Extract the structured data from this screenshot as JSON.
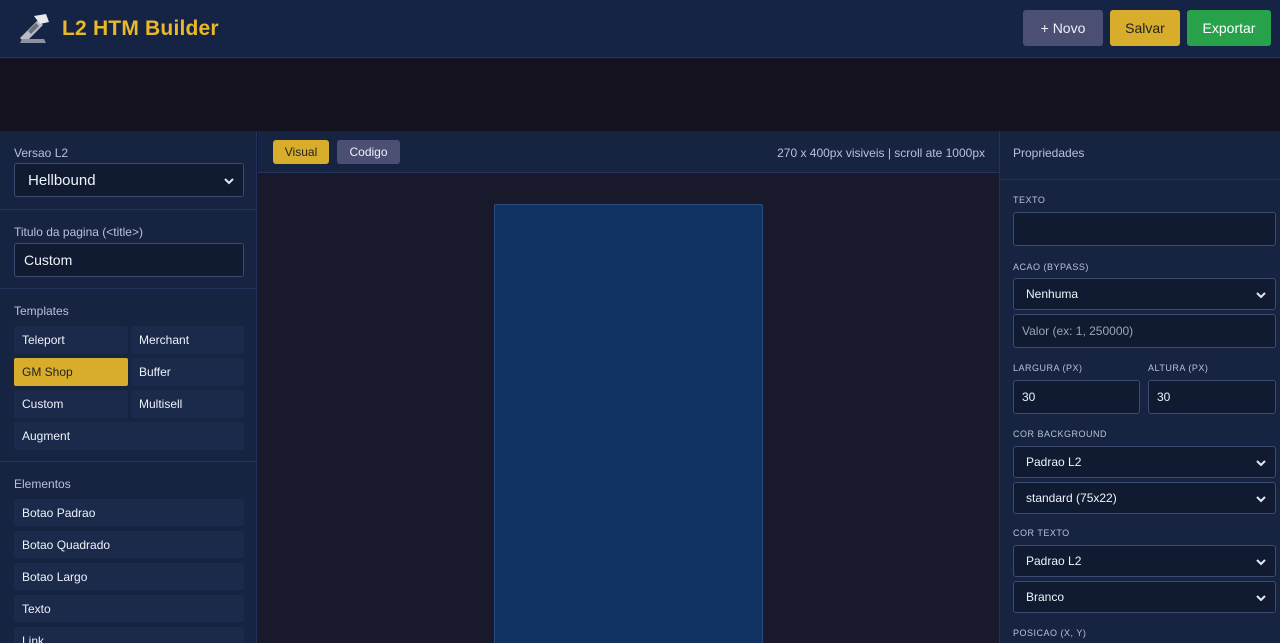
{
  "header": {
    "title": "L2 HTM Builder",
    "buttons": {
      "novo": "+ Novo",
      "salvar": "Salvar",
      "exportar": "Exportar"
    }
  },
  "sidebar": {
    "version": {
      "label": "Versao L2",
      "value": "Hellbound"
    },
    "page_title": {
      "label": "Titulo da pagina (<title>)",
      "value": "Custom"
    },
    "templates": {
      "label": "Templates",
      "items": [
        "Teleport",
        "Merchant",
        "GM Shop",
        "Buffer",
        "Custom",
        "Multisell",
        "Augment"
      ],
      "active": "GM Shop"
    },
    "elements": {
      "label": "Elementos",
      "items": [
        "Botao Padrao",
        "Botao Quadrado",
        "Botao Largo",
        "Texto",
        "Link"
      ]
    }
  },
  "editor": {
    "tabs": {
      "visual": "Visual",
      "codigo": "Codigo"
    },
    "active_tab": "Visual",
    "info": "270 x 400px visiveis | scroll ate 1000px"
  },
  "properties": {
    "title": "Propriedades",
    "texto": {
      "label": "TEXTO",
      "value": ""
    },
    "acao": {
      "label": "ACAO (BYPASS)",
      "value": "Nenhuma",
      "param_placeholder": "Valor (ex: 1, 250000)"
    },
    "largura": {
      "label": "LARGURA (PX)",
      "value": "30"
    },
    "altura": {
      "label": "ALTURA (PX)",
      "value": "30"
    },
    "cor_background": {
      "label": "COR BACKGROUND",
      "value": "Padrao L2",
      "texture": "standard (75x22)"
    },
    "cor_texto": {
      "label": "COR TEXTO",
      "value": "Padrao L2",
      "color": "Branco"
    },
    "posicao": {
      "label": "POSICAO (X, Y)"
    }
  },
  "colors": {
    "accent": "#d9ad2c",
    "export": "#27a24a",
    "header_bg": "#152344",
    "canvas_bg": "#0f3262"
  }
}
